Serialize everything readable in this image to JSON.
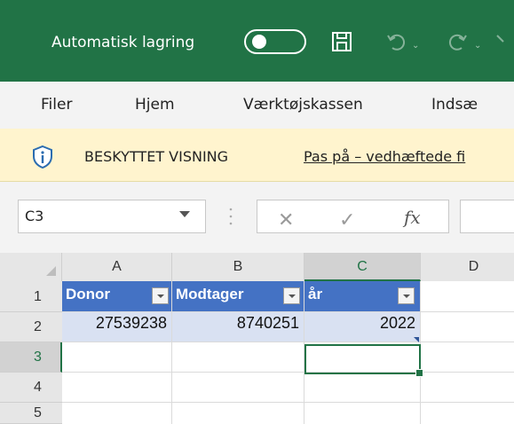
{
  "titlebar": {
    "autosave_label": "Automatisk lagring",
    "autosave_state": "off",
    "icons": [
      "toggle-icon",
      "save-icon",
      "undo-icon",
      "redo-icon"
    ]
  },
  "menu": {
    "items": [
      "Filer",
      "Hjem",
      "Værktøjskassen",
      "Indsæ"
    ]
  },
  "protected_view": {
    "title": "BESKYTTET VISNING",
    "message": "Pas på – vedhæftede fi"
  },
  "formula": {
    "name_box": "C3",
    "fx_label": "fx",
    "value": ""
  },
  "grid": {
    "columns": [
      "A",
      "B",
      "C",
      "D"
    ],
    "rows": [
      "1",
      "2",
      "3",
      "4",
      "5"
    ],
    "header_row": [
      "Donor",
      "Modtager",
      "år"
    ],
    "data_row": [
      "27539238",
      "8740251",
      "2022"
    ]
  },
  "colors": {
    "excel_green": "#217346",
    "table_header": "#4472c4",
    "table_band": "#d9e1f2",
    "protected_bar": "#fff4ce"
  }
}
